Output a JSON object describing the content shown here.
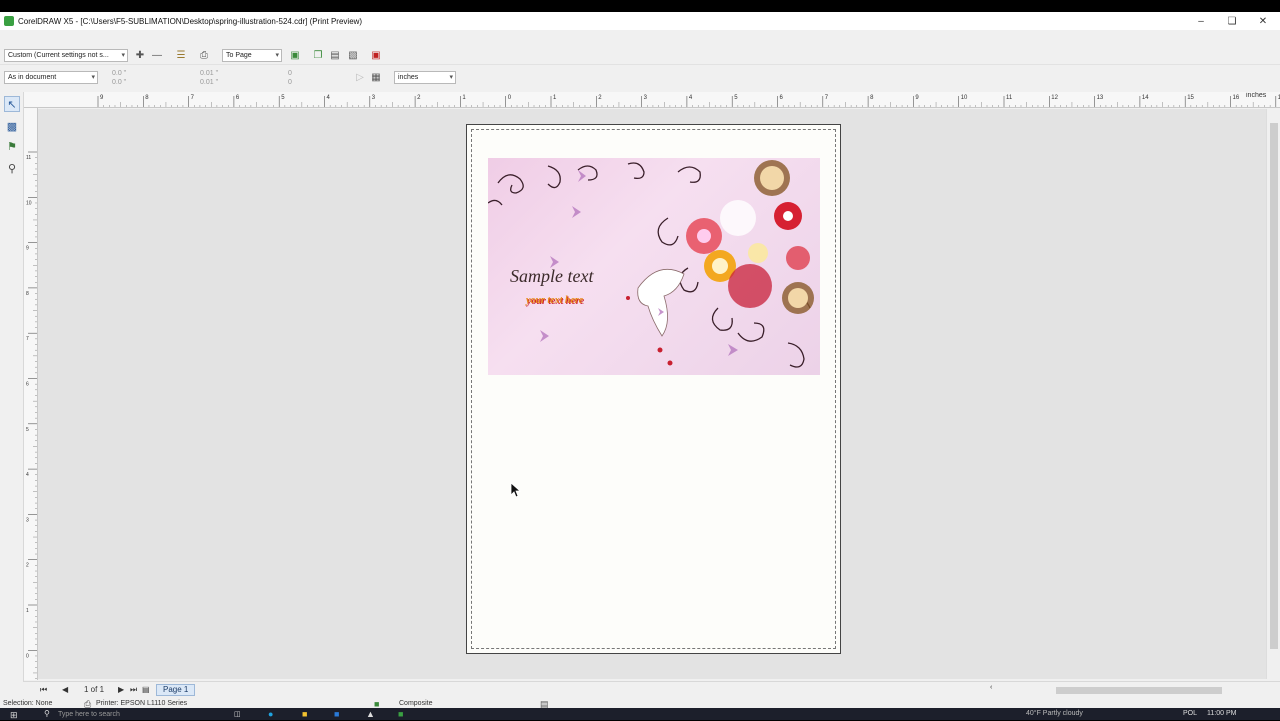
{
  "window": {
    "title": "CorelDRAW X5 - [C:\\Users\\F5-SUBLIMATION\\Desktop\\spring-illustration-524.cdr] (Print Preview)"
  },
  "toolbar": {
    "print_style": "Custom (Current settings not s...",
    "zoom": "To Page",
    "position_preset": "As in document",
    "x_value": "0.0 \"",
    "y_value": "0.0 \"",
    "width_value": "0.01 \"",
    "height_value": "0.01 \"",
    "scale_x": "0",
    "scale_y": "0",
    "units": "inches"
  },
  "rulers": {
    "h_ticks": [
      "9",
      "8",
      "7",
      "6",
      "5",
      "4",
      "3",
      "2",
      "1",
      "0",
      "1",
      "2",
      "3",
      "4",
      "5",
      "6",
      "7",
      "8",
      "9",
      "10",
      "11",
      "12",
      "13",
      "14",
      "15",
      "16",
      "17"
    ],
    "h_units": "inches",
    "v_ticks": [
      "11",
      "10",
      "9",
      "8",
      "7",
      "6",
      "5",
      "4",
      "3",
      "2",
      "1",
      "0"
    ]
  },
  "artwork": {
    "sample_text": "Sample text",
    "your_text": "your text here"
  },
  "pagebar": {
    "page_count": "1 of 1",
    "page_tab": "Page 1"
  },
  "status": {
    "selection": "Selection: None",
    "printer": "Printer: EPSON L1110 Series",
    "mode": "Composite"
  },
  "taskbar": {
    "search_placeholder": "Type here to search",
    "weather": "40°F  Partly cloudy",
    "language": "POL",
    "time": "11:00 PM"
  }
}
